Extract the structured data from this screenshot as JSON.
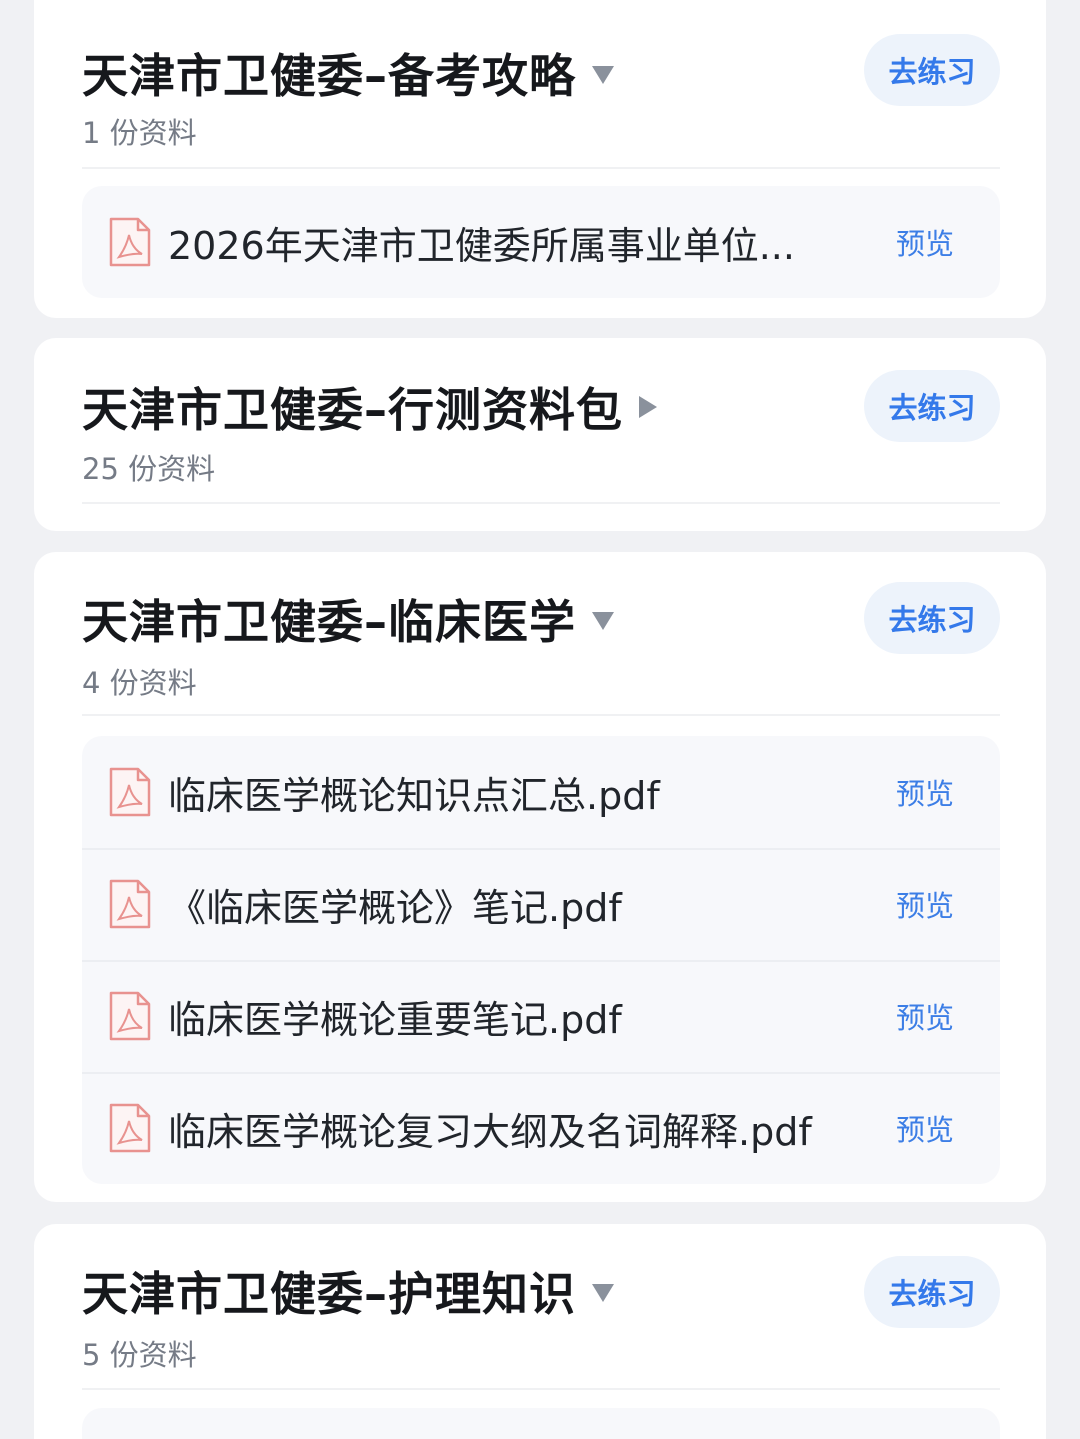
{
  "groups": [
    {
      "title": "天津市卫健委–备考攻略",
      "count": "1 份资料",
      "practice_label": "去练习",
      "expanded": true,
      "files": [
        {
          "name": "2026年天津市卫健委所属事业单位...",
          "preview_label": "预览",
          "icon": "pdf-icon"
        }
      ]
    },
    {
      "title": "天津市卫健委–行测资料包",
      "count": "25 份资料",
      "practice_label": "去练习",
      "expanded": false,
      "files": []
    },
    {
      "title": "天津市卫健委–临床医学",
      "count": "4 份资料",
      "practice_label": "去练习",
      "expanded": true,
      "files": [
        {
          "name": "临床医学概论知识点汇总.pdf",
          "preview_label": "预览",
          "icon": "pdf-icon"
        },
        {
          "name": "《临床医学概论》笔记.pdf",
          "preview_label": "预览",
          "icon": "pdf-icon"
        },
        {
          "name": "临床医学概论重要笔记.pdf",
          "preview_label": "预览",
          "icon": "pdf-icon"
        },
        {
          "name": "临床医学概论复习大纲及名词解释.pdf",
          "preview_label": "预览",
          "icon": "pdf-icon"
        }
      ]
    },
    {
      "title": "天津市卫健委–护理知识",
      "count": "5 份资料",
      "practice_label": "去练习",
      "expanded": true,
      "files": []
    }
  ],
  "colors": {
    "accent": "#3479ea",
    "button_bg": "#edf3fb",
    "pdf_icon": "#e8928f",
    "page_bg": "#f0f1f4"
  }
}
